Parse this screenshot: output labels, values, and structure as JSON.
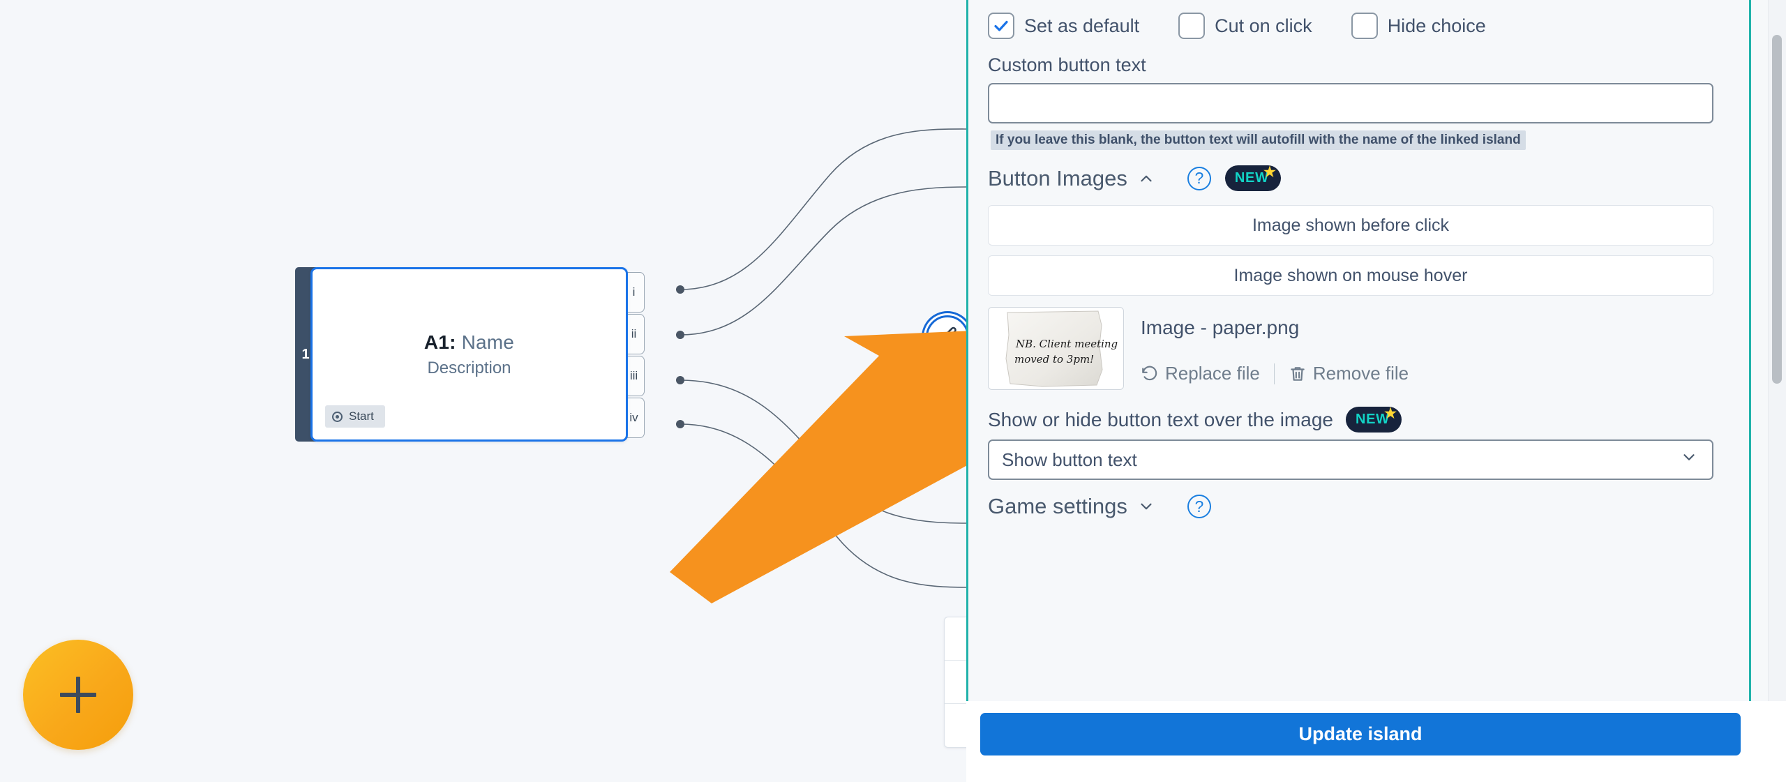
{
  "canvas": {
    "node": {
      "index": "1",
      "title_prefix": "A1:",
      "title_name": "Name",
      "description": "Description",
      "start_chip": "Start",
      "tabs": [
        "i",
        "ii",
        "iii",
        "iv"
      ]
    },
    "fab_label": "+",
    "zoom_toolbar": [
      "fit-to-screen-icon",
      "zoom-in-icon",
      "zoom-out-icon"
    ],
    "edit_button_icon": "pencil-icon",
    "annotation": "orange-arrow-pointing-to-image-shown-on-mouse-hover"
  },
  "panel": {
    "checkboxes": [
      {
        "label": "Set as default",
        "checked": true
      },
      {
        "label": "Cut on click",
        "checked": false
      },
      {
        "label": "Hide choice",
        "checked": false
      }
    ],
    "custom_button_text": {
      "label": "Custom button text",
      "value": "",
      "placeholder": "",
      "hint": "If you leave this blank, the button text will autofill with the name of the linked island"
    },
    "button_images": {
      "title": "Button Images",
      "collapse_icon": "chevron-up-icon",
      "help_icon": "question-circle-icon",
      "badge": "NEW",
      "badge_star": "★",
      "before_click_label": "Image shown before click",
      "hover_label": "Image shown on mouse hover",
      "file": {
        "name": "Image - paper.png",
        "thumb_text_line1": "NB. Client meeting",
        "thumb_text_line2": "moved to 3pm!",
        "replace_label": "Replace file",
        "replace_icon": "rotate-left-icon",
        "remove_label": "Remove file",
        "remove_icon": "trash-icon"
      },
      "overlay_setting": {
        "label": "Show or hide button text over the image",
        "badge": "NEW",
        "selected": "Show button text",
        "chevron_icon": "chevron-down-icon"
      }
    },
    "game_settings": {
      "title": "Game settings",
      "collapse_icon": "chevron-down-icon",
      "help_icon": "question-circle-icon"
    },
    "footer": {
      "update_label": "Update island"
    }
  },
  "colors": {
    "accent_blue": "#1275d8",
    "panel_border_teal": "#20b2aa",
    "badge_bg": "#17233c",
    "badge_text": "#12d3c6",
    "badge_star": "#ffd633",
    "fab_orange": "#f9a81a",
    "annotation_orange": "#f6921e",
    "text_slate": "#42526b"
  }
}
